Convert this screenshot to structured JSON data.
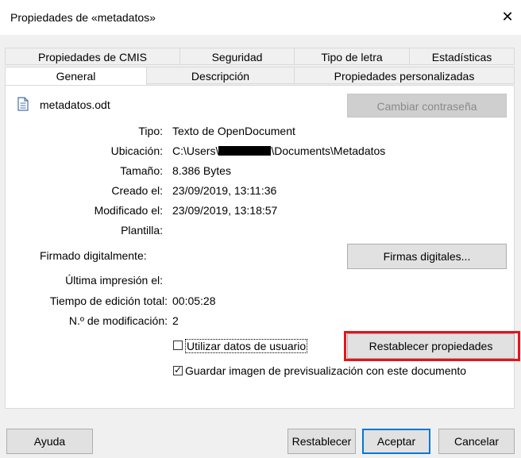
{
  "window": {
    "title": "Propiedades de «metadatos»"
  },
  "tabs_top": [
    "Propiedades de CMIS",
    "Seguridad",
    "Tipo de letra",
    "Estadísticas"
  ],
  "tabs_bottom": [
    "General",
    "Descripción",
    "Propiedades personalizadas"
  ],
  "general": {
    "filename": "metadatos.odt",
    "change_password_label": "Cambiar contraseña",
    "fields": [
      {
        "label": "Tipo:",
        "value": "Texto de OpenDocument"
      },
      {
        "label": "Ubicación:",
        "value_prefix": "C:\\Users\\",
        "value_suffix": "\\Documents\\Metadatos"
      },
      {
        "label": "Tamaño:",
        "value": "8.386 Bytes"
      },
      {
        "label": "Creado el:",
        "value": "23/09/2019, 13:11:36"
      },
      {
        "label": "Modificado el:",
        "value": "23/09/2019, 13:18:57"
      },
      {
        "label": "Plantilla:",
        "value": ""
      }
    ],
    "signed_label": "Firmado digitalmente:",
    "digital_signatures_label": "Firmas digitales...",
    "last_print_label": "Última impresión el:",
    "edit_time_label": "Tiempo de edición total:",
    "edit_time_value": "00:05:28",
    "revision_label": "N.º de modificación:",
    "revision_value": "2",
    "use_user_data_label": "Utilizar datos de usuario",
    "reset_properties_label": "Restablecer propiedades",
    "save_preview_label": "Guardar imagen de previsualización con este documento"
  },
  "footer": {
    "help": "Ayuda",
    "reset": "Restablecer",
    "ok": "Aceptar",
    "cancel": "Cancelar"
  },
  "colors": {
    "highlight": "#e4141b",
    "accent": "#0078d7"
  }
}
